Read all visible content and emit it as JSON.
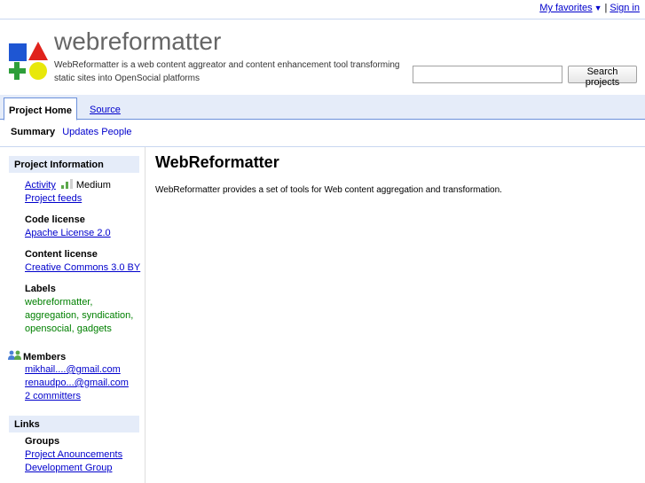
{
  "topbar": {
    "favorites_label": "My favorites",
    "favorites_caret": "▼",
    "separator": "|",
    "signin_label": "Sign in"
  },
  "header": {
    "project_name": "webreformatter",
    "summary": "WebReformatter is a web content aggreator and content enhancement tool transforming static sites into OpenSocial platforms",
    "logo_icon": "project-logo-shapes-icon",
    "search_placeholder": "",
    "search_value": "",
    "search_button_label": "Search projects"
  },
  "tabs": {
    "project_home": "Project Home",
    "source": "Source"
  },
  "subtabs": {
    "summary": "Summary",
    "updates": "Updates",
    "people": "People"
  },
  "sidebar": {
    "project_info_header": "Project Information",
    "activity_label": "Activity",
    "activity_level": "Medium",
    "activity_meter_level": 0.66,
    "project_feeds": "Project feeds",
    "code_license_label": "Code license",
    "code_license_value": "Apache License 2.0",
    "content_license_label": "Content license",
    "content_license_value": "Creative Commons 3.0 BY",
    "labels_label": "Labels",
    "labels": [
      "webreformatter",
      "aggregation",
      "syndication",
      "opensocial",
      "gadgets"
    ],
    "members_label": "Members",
    "members": [
      "mikhail....@gmail.com",
      "renaudpo...@gmail.com"
    ],
    "committers": "2 committers",
    "links_header": "Links",
    "groups_label": "Groups",
    "groups": [
      "Project Anouncements",
      "Development Group"
    ]
  },
  "content": {
    "title": "WebReformatter",
    "description": "WebReformatter provides a set of tools for Web content aggregation and transformation."
  },
  "colors": {
    "link": "#0000cc",
    "label_green": "#008000",
    "tab_bg": "#e5ecf9",
    "title_gray": "#666666"
  }
}
